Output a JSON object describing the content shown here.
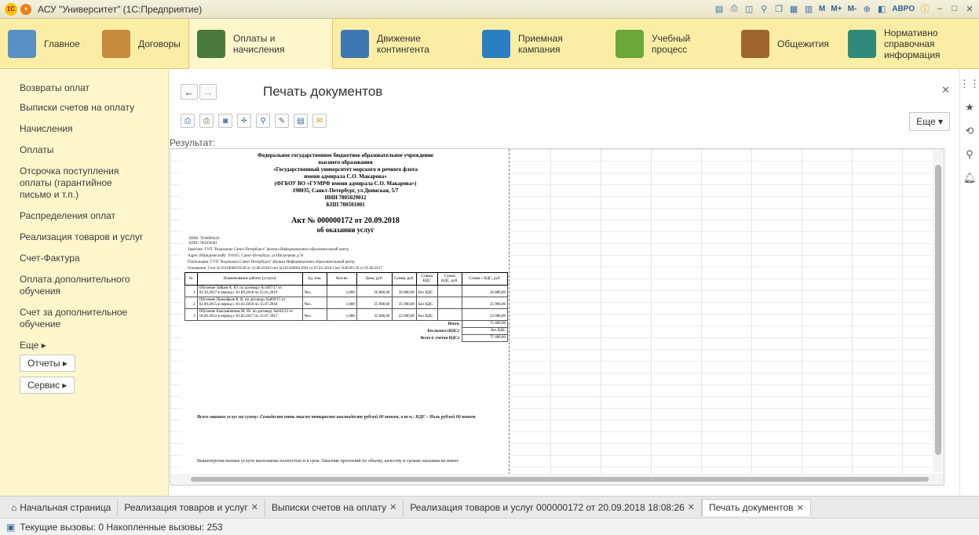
{
  "window": {
    "title": "АСУ \"Университет\" (1С:Предприятие)",
    "right_m": "M",
    "right_mplus": "M+",
    "right_mminus": "M-",
    "user": "АВРО"
  },
  "sections": [
    {
      "label": "Главное",
      "color": "#5a8fc4"
    },
    {
      "label": "Договоры",
      "color": "#c7893d"
    },
    {
      "label": "Оплаты и начисления",
      "color": "#4a7a3a"
    },
    {
      "label": "Движение контингента",
      "color": "#3b77b5"
    },
    {
      "label": "Приемная кампания",
      "color": "#2b7ec1"
    },
    {
      "label": "Учебный процесс",
      "color": "#6aa83a"
    },
    {
      "label": "Общежития",
      "color": "#a0652c"
    },
    {
      "label": "Нормативно справочная информация",
      "color": "#2e8a7a"
    }
  ],
  "sidebar": {
    "links": [
      "Возвраты оплат",
      "Выписки счетов на оплату",
      "Начисления",
      "Оплаты",
      "Отсрочка поступления оплаты (гарантийное письмо и т.п.)",
      "Распределения оплат",
      "Реализация товаров и услуг",
      "Счет-Фактура",
      "Оплата дополнительного обучения",
      "Счет за дополнительное обучение",
      "Еще ▸"
    ],
    "buttons": [
      "Отчеты ▸",
      "Сервис ▸"
    ]
  },
  "form": {
    "title": "Печать документов",
    "more": "Еще ▾",
    "result_label": "Результат:"
  },
  "doc": {
    "header_lines": [
      "Федеральное государственное бюджетное образовательное учреждение",
      "высшего образования",
      "«Государственный университет морского и речного флота",
      "имени адмирала С.О. Макарова»",
      "(ФГБОУ ВО «ГУМРФ имени адмирала С.О. Макарова»)",
      "198035, Санкт-Петербург, ул.Двинская, 5/7",
      "ИНН 7805029012",
      "КПП 780501001"
    ],
    "act_title": "Акт № 000000172 от 20.09.2018",
    "act_subtitle": "об оказании услуг",
    "customer": "Заказчик: ГУП \"Водоканал Санкт-Петербурга\" филиал Информационно-образовательный центр",
    "address": "Адрес (Юридический): 191015, Санкт-Петербург, ул.Шпалерная д.56",
    "payer": "Плательщик: ГУП \"Водоканал Санкт-Петербурга\" филиал Информационно-образовательный центр",
    "inn": "ИНН: 7830000426",
    "kpp": "КПП: 784202001",
    "basis": "Основание: Счет №1011800019549 от 31.08.2018 Счет №1011800013694 от 07.02.2018 Счет №ФЭО-20 от 05.06.2017",
    "table_headers": [
      "№",
      "Наименование работы (услуги)",
      "Ед. изм.",
      "Кол-во",
      "Цена, руб.",
      "Сумма, руб.",
      "Ставка НДС",
      "Сумма НДС, руб.",
      "Сумма с НДС, руб."
    ],
    "rows": [
      [
        "1",
        "Обучение Зайцев А. Ю. по договору №1007/17 от 03.10.2017 в период с 01.09.2018 по 25.01.2019",
        "Чел.",
        "1,000",
        "26 880,00",
        "26 880,00",
        "Без НДС",
        "",
        "26 880,00"
      ],
      [
        "2",
        "Обучение Прокофьев В. К. по договору №869/15 от 02.09.2015 в период с 01.02.2018 по 15.07.2018",
        "Чел.",
        "1,000",
        "25 900,00",
        "25 900,00",
        "Без НДС",
        "",
        "25 900,00"
      ],
      [
        "3",
        "Обучение Емельяненков М. Ю. по договору №843/12 от 18.09.2012 в период с 01.02.2017 по 15.07.2017",
        "Чел.",
        "1,000",
        "22 680,00",
        "22 680,00",
        "Без НДС",
        "",
        "22 680,00"
      ]
    ],
    "total_label": "Итого:",
    "total_value": "75 460,00",
    "no_vat_label": "Без налога (НДС):",
    "no_vat_value": "Без НДС",
    "total_vat_label": "Всего (с учетом НДС):",
    "total_vat_value": "75 460,00",
    "sum_words": "Всего оказано услуг на сумму: Семьдесят пять тысяч четыреста шестьдесят рублей 00 копеек, в т.ч.: НДС - Ноль рублей 00 копеек",
    "footer": "Вышеперечисленные услуги выполнены полностью и в срок. Заказчик претензий по объему, качеству и срокам оказания не имеет."
  },
  "tabs": [
    "Начальная страница",
    "Реализация товаров и услуг",
    "Выписки счетов на оплату",
    "Реализация товаров и услуг 000000172 от 20.09.2018 18:08:26",
    "Печать документов"
  ],
  "status": {
    "text": "Текущие вызовы: 0   Накопленные вызовы: 253"
  }
}
